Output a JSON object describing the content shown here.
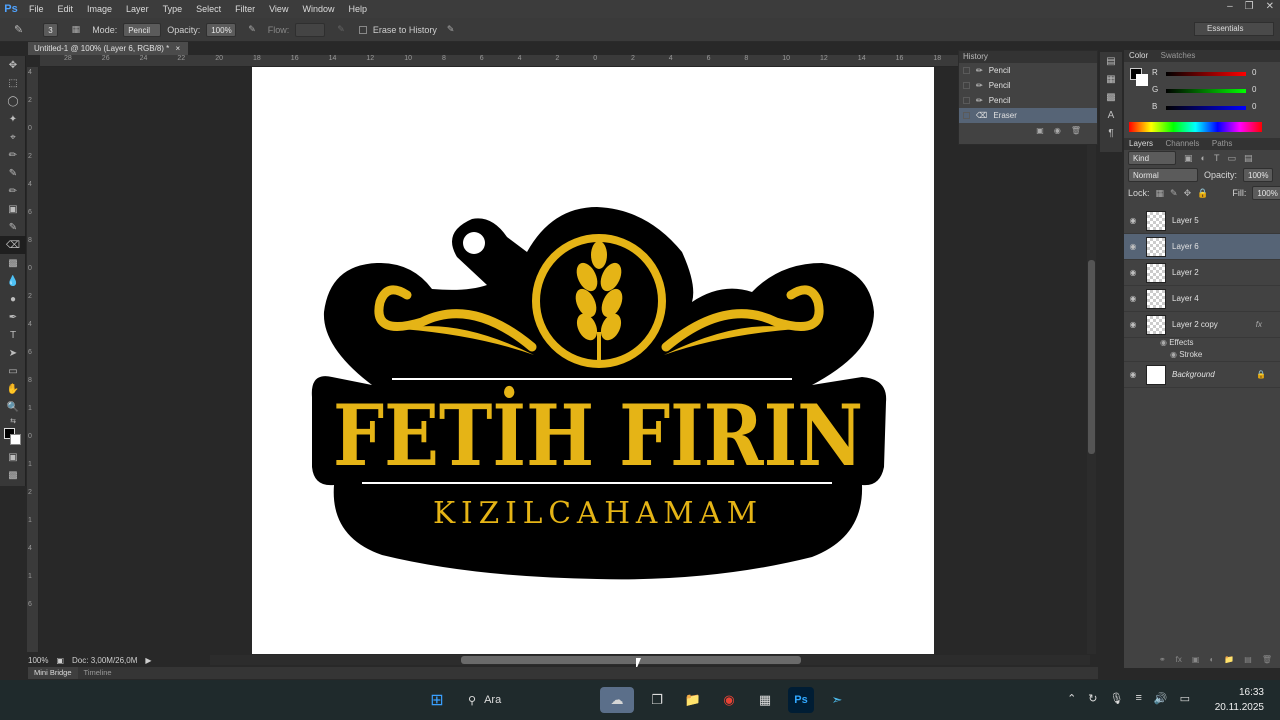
{
  "app": {
    "logo": "Ps"
  },
  "menu": [
    "File",
    "Edit",
    "Image",
    "Layer",
    "Type",
    "Select",
    "Filter",
    "View",
    "Window",
    "Help"
  ],
  "options": {
    "brush_size": "3",
    "mode_label": "Mode:",
    "mode_value": "Pencil",
    "opacity_label": "Opacity:",
    "opacity_value": "100%",
    "flow_label": "Flow:",
    "erase_history_label": "Erase to History",
    "workspace": "Essentials"
  },
  "document": {
    "tab_title": "Untitled-1 @ 100% (Layer 6, RGB/8) *"
  },
  "ruler": {
    "h_ticks": [
      "28",
      "26",
      "24",
      "22",
      "20",
      "18",
      "16",
      "14",
      "12",
      "10",
      "8",
      "6",
      "4",
      "2",
      "0",
      "2",
      "4",
      "6",
      "8",
      "10",
      "12",
      "14",
      "16",
      "18"
    ],
    "v_ticks": [
      "4",
      "2",
      "0",
      "2",
      "4",
      "6",
      "8",
      "0",
      "2",
      "4",
      "6",
      "8",
      "1",
      "0",
      "1",
      "2",
      "1",
      "4",
      "1",
      "6"
    ]
  },
  "logo_art": {
    "title": "FETİH FIRIN",
    "subtitle": "KIZILCAHAMAM",
    "colors": {
      "gold": "#e5b416",
      "black": "#000000"
    }
  },
  "status": {
    "zoom": "100%",
    "doc": "Doc: 3,00M/26,0M"
  },
  "bottom_tabs": [
    "Mini Bridge",
    "Timeline"
  ],
  "history": {
    "title": "History",
    "items": [
      {
        "label": "Pencil",
        "icon": "pencil-icon",
        "selected": false
      },
      {
        "label": "Pencil",
        "icon": "pencil-icon",
        "selected": false
      },
      {
        "label": "Pencil",
        "icon": "pencil-icon",
        "selected": false
      },
      {
        "label": "Eraser",
        "icon": "eraser-icon",
        "selected": true
      }
    ]
  },
  "color_panel": {
    "tabs": [
      "Color",
      "Swatches"
    ],
    "r_label": "R",
    "r_value": "0",
    "g_label": "G",
    "g_value": "0",
    "b_label": "B",
    "b_value": "0"
  },
  "layers_panel": {
    "tabs": [
      "Layers",
      "Channels",
      "Paths"
    ],
    "kind": "Kind",
    "blend_mode": "Normal",
    "opacity_label": "Opacity:",
    "opacity_value": "100%",
    "lock_label": "Lock:",
    "fill_label": "Fill:",
    "fill_value": "100%",
    "layers": [
      {
        "name": "Layer 5",
        "selected": false
      },
      {
        "name": "Layer 6",
        "selected": true
      },
      {
        "name": "Layer 2",
        "selected": false
      },
      {
        "name": "Layer 4",
        "selected": false
      },
      {
        "name": "Layer 2 copy",
        "selected": false,
        "fx": "fx"
      }
    ],
    "effects_label": "Effects",
    "stroke_label": "Stroke",
    "background_label": "Background"
  },
  "taskbar": {
    "search_placeholder": "Ara",
    "time": "16:33",
    "date": "20.11.2025"
  }
}
